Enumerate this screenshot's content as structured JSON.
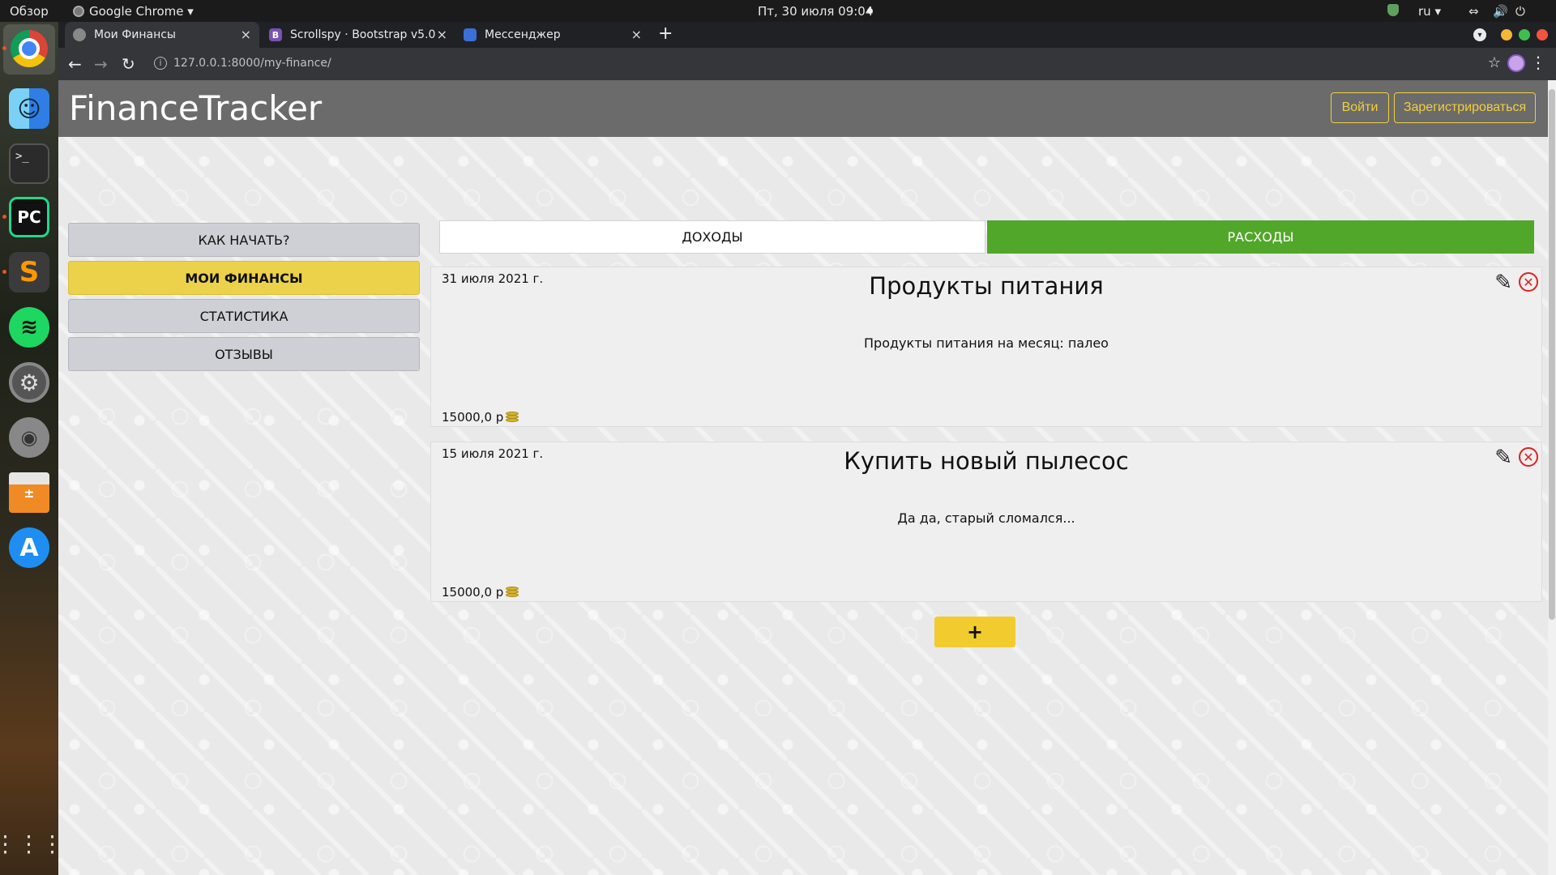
{
  "os": {
    "overview": "Обзор",
    "active_app": "Google Chrome ▾",
    "clock": "Пт, 30 июля  09:04",
    "lang": "ru ▾",
    "tray_net": "⇔",
    "tray_volume": "🔊",
    "tray_power": "⏻"
  },
  "browser": {
    "tabs": [
      {
        "title": "Мои Финансы",
        "favicon": "globe-icon"
      },
      {
        "title": "Scrollspy · Bootstrap v5.0",
        "favicon": "B"
      },
      {
        "title": "Мессенджер",
        "favicon": "chat-icon"
      }
    ],
    "new_tab": "+",
    "url": "127.0.0.1:8000/my-finance/",
    "close_glyph": "×",
    "back_glyph": "←",
    "forward_glyph": "→",
    "reload_glyph": "↻",
    "info_glyph": "i",
    "star_glyph": "☆",
    "menu_glyph": "⋮"
  },
  "site": {
    "brand": "FinanceTracker",
    "login": "Войти",
    "register": "Зарегистрироваться",
    "sidebar": [
      {
        "label": "КАК НАЧАТЬ?",
        "active": false
      },
      {
        "label": "МОИ ФИНАНСЫ",
        "active": true
      },
      {
        "label": "СТАТИСТИКА",
        "active": false
      },
      {
        "label": "ОТЗЫВЫ",
        "active": false
      }
    ],
    "type_tabs": {
      "income": "ДОХОДЫ",
      "expense": "РАСХОДЫ",
      "selected": "expense"
    },
    "records": [
      {
        "date": "31 июля 2021 г.",
        "title": "Продукты питания",
        "description": "Продукты питания на месяц: палео",
        "amount": "15000,0 р"
      },
      {
        "date": "15 июля 2021 г.",
        "title": "Купить новый пылесос",
        "description": "Да да, старый сломался...",
        "amount": "15000,0 р"
      }
    ],
    "add_label": "+"
  },
  "colors": {
    "header_bg": "#6b6b6b",
    "accent_yellow": "#f2cc2e",
    "expense_green": "#51a729",
    "delete_red": "#e02020"
  }
}
